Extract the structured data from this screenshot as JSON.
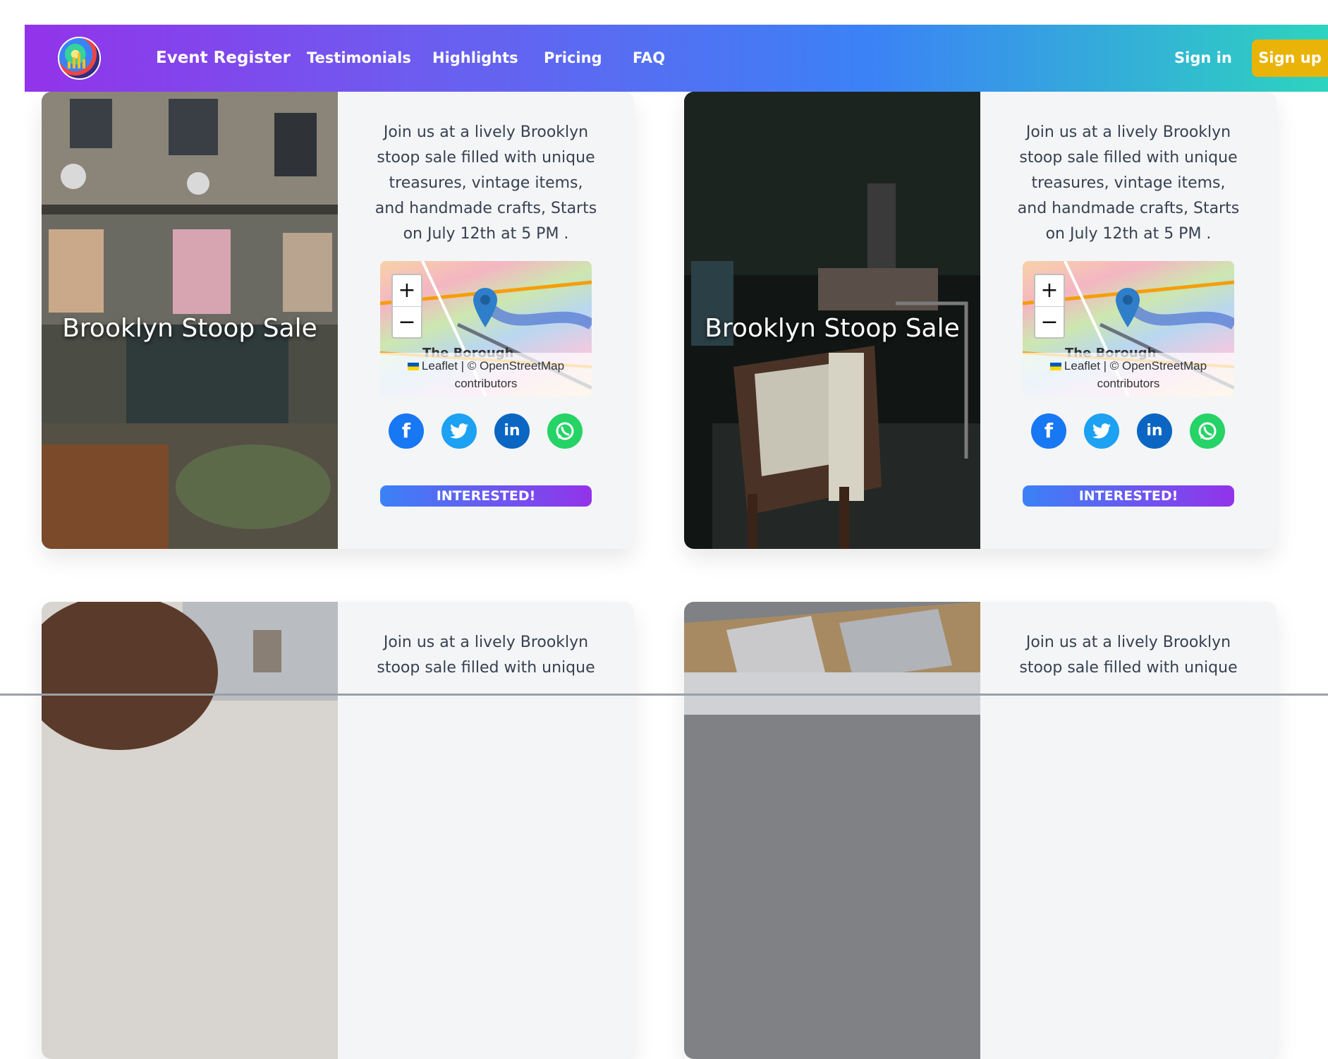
{
  "nav": {
    "brand": "Event Register",
    "links": [
      "Testimonials",
      "Highlights",
      "Pricing",
      "FAQ"
    ],
    "sign_in": "Sign in",
    "sign_up": "Sign up"
  },
  "events": [
    {
      "title": "Brooklyn Stoop Sale",
      "description": "Join us at a lively Brooklyn stoop sale filled with unique treasures, vintage items, and handmade crafts, Starts on July 12th at 5 PM .",
      "image_icon": "street-market-photo",
      "map": {
        "place": "The Borough",
        "attribution_1": "Leaflet | © OpenStreetMap",
        "attribution_2": "contributors",
        "zoom_in": "+",
        "zoom_out": "−"
      },
      "cta": "INTERESTED!"
    },
    {
      "title": "Brooklyn Stoop Sale",
      "description": "Join us at a lively Brooklyn stoop sale filled with unique treasures, vintage items, and handmade crafts, Starts on July 12th at 5 PM .",
      "image_icon": "vintage-chair-photo",
      "map": {
        "place": "The Borough",
        "attribution_1": "Leaflet | © OpenStreetMap",
        "attribution_2": "contributors",
        "zoom_in": "+",
        "zoom_out": "−"
      },
      "cta": "INTERESTED!"
    },
    {
      "description": "Join us at a lively Brooklyn stoop sale filled with unique",
      "image_icon": "person-photo"
    },
    {
      "description": "Join us at a lively Brooklyn stoop sale filled with unique",
      "image_icon": "boxes-photo"
    }
  ],
  "social_icons": [
    "facebook-icon",
    "twitter-icon",
    "linkedin-icon",
    "whatsapp-icon"
  ],
  "colors": {
    "nav_gradient": [
      "#9333ea",
      "#3b82f6",
      "#2dd4bf"
    ],
    "signup": "#eab308",
    "facebook": "#1877f2",
    "twitter": "#1da1f2",
    "linkedin": "#0a66c2",
    "whatsapp": "#25d366",
    "cta_gradient": [
      "#3b82f6",
      "#9333ea"
    ]
  }
}
